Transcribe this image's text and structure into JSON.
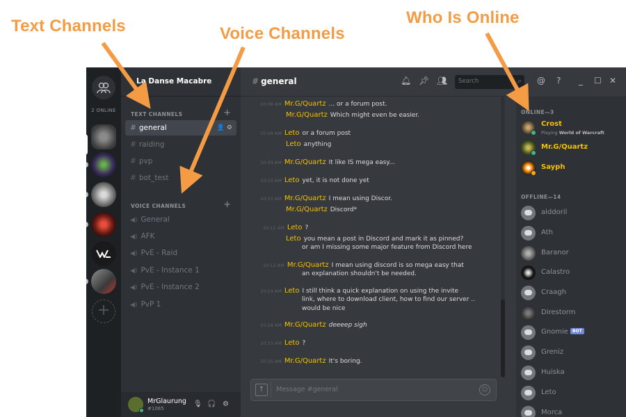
{
  "annotations": {
    "text_channels": "Text Channels",
    "voice_channels": "Voice Channels",
    "who_is_online": "Who Is Online"
  },
  "colors": {
    "accent_orange": "#f39c45",
    "username_gold": "#f7c100",
    "online_green": "#43b581",
    "idle_orange": "#faa61a",
    "bot_blue": "#7289da"
  },
  "rail": {
    "online_count": "2 ONLINE",
    "home_icon": "friends-icon",
    "add_icon": "plus-icon"
  },
  "guild": {
    "name": "La Danse Macabre"
  },
  "sidebar": {
    "text_category": "TEXT CHANNELS",
    "voice_category": "VOICE CHANNELS",
    "text_channels": [
      "general",
      "raiding",
      "pvp",
      "bot_test"
    ],
    "voice_channels": [
      "General",
      "AFK",
      "PvE - Raid",
      "PvE - Instance 1",
      "PvE - Instance 2",
      "PvP 1"
    ]
  },
  "user": {
    "name": "MrGlaurung",
    "discriminator": "#1065"
  },
  "chat": {
    "channel": "general",
    "search_placeholder": "Search",
    "composer_placeholder": "Message #general",
    "messages": [
      {
        "time": "10:08 AM",
        "author": "Mr.G/Quartz",
        "text": "... or a forum post."
      },
      {
        "time": "",
        "author": "Mr.G/Quartz",
        "text": "Which might even be easier."
      },
      {
        "time": "10:09 AM",
        "author": "Leto",
        "text": "or a forum post"
      },
      {
        "time": "",
        "author": "Leto",
        "text": "anything"
      },
      {
        "time": "10:09 AM",
        "author": "Mr.G/Quartz",
        "text": "It like IS mega easy..."
      },
      {
        "time": "10:10 AM",
        "author": "Leto",
        "text": "yet, it is not done yet"
      },
      {
        "time": "10:10 AM",
        "author": "Mr.G/Quartz",
        "text": "I mean using Discor."
      },
      {
        "time": "",
        "author": "Mr.G/Quartz",
        "text": "Discord*"
      },
      {
        "time": "10:11 AM",
        "author": "Leto",
        "text": "?"
      },
      {
        "time": "",
        "author": "Leto",
        "text": "you mean a post in Discord and mark it as pinned?"
      },
      {
        "time": "",
        "author": "",
        "text": "or am I missing some major feature from Discord here"
      },
      {
        "time": "10:12 AM",
        "author": "Mr.G/Quartz",
        "text": "I mean using discord is so mega easy that"
      },
      {
        "time": "",
        "author": "",
        "text": "an explanation shouldn't be needed."
      },
      {
        "time": "10:14 AM",
        "author": "Leto",
        "text": "I still think a quick explanation on using the invite"
      },
      {
        "time": "",
        "author": "",
        "text": "link, where to download client, how to find our server .."
      },
      {
        "time": "",
        "author": "",
        "text": "would be nice"
      },
      {
        "time": "10:18 AM",
        "author": "Mr.G/Quartz",
        "text": "deeeep sigh"
      },
      {
        "time": "10:33 AM",
        "author": "Leto",
        "text": "?"
      },
      {
        "time": "10:35 AM",
        "author": "Mr.G/Quartz",
        "text": "It's boring."
      }
    ]
  },
  "members": {
    "online_header": "ONLINE—3",
    "offline_header": "OFFLINE—14",
    "online": [
      {
        "name": "Crost",
        "game_prefix": "Playing ",
        "game": "World of Warcraft",
        "status": "online"
      },
      {
        "name": "Mr.G/Quartz",
        "status": "online"
      },
      {
        "name": "Sayph",
        "status": "idle"
      }
    ],
    "offline": [
      {
        "name": "alddoril"
      },
      {
        "name": "Ath"
      },
      {
        "name": "Baranor"
      },
      {
        "name": "Calastro"
      },
      {
        "name": "Craagh"
      },
      {
        "name": "Direstorm"
      },
      {
        "name": "Gnomie",
        "bot": "BOT"
      },
      {
        "name": "Greniz"
      },
      {
        "name": "Huiska"
      },
      {
        "name": "Leto"
      },
      {
        "name": "Morca"
      }
    ]
  },
  "header_icons": [
    "bell-icon",
    "pin-icon",
    "members-icon",
    "search-icon",
    "mention-icon",
    "help-icon",
    "minimize-icon",
    "maximize-icon",
    "close-icon"
  ]
}
